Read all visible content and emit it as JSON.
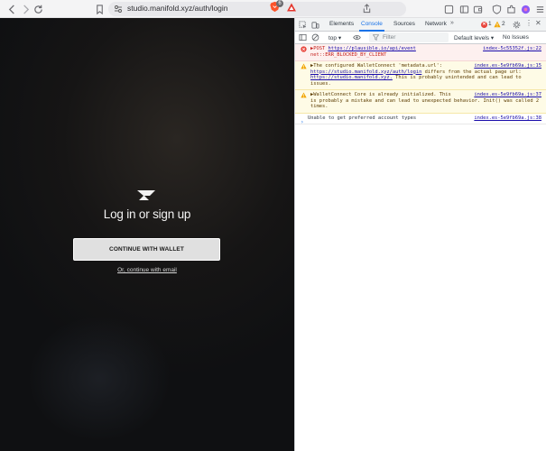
{
  "browser": {
    "url": "studio.manifold.xyz/auth/login",
    "brave_badge_count": "6",
    "tab_count": "6"
  },
  "page": {
    "title": "Log in or sign up",
    "wallet_button": "CONTINUE WITH WALLET",
    "email_link": "Or, continue with email"
  },
  "devtools": {
    "tabs": [
      "Elements",
      "Console",
      "Sources",
      "Network"
    ],
    "active_tab": "Console",
    "more": "»",
    "error_count": "1",
    "warning_count": "2",
    "context": "top",
    "filter_placeholder": "Filter",
    "levels": "Default levels",
    "issues": "No Issues",
    "messages": [
      {
        "type": "error",
        "line1_prefix": "▶POST ",
        "line1_link": "https://plausible.io/api/event",
        "line2": "net::ERR_BLOCKED_BY_CLIENT",
        "source": "index-5c55352f.js:22"
      },
      {
        "type": "warning",
        "line1": "▶The configured WalletConnect 'metadata.url':",
        "link1": "https://studio.manifold.xyz/auth/login",
        "text2": " differs from the actual page url:",
        "link2": "https://studio.manifold.xyz.",
        "text3": " This is probably unintended and can lead to issues.",
        "source": "index.es-5e9fb69a.js:15"
      },
      {
        "type": "warning",
        "line1": "▶WalletConnect Core is already initialized. This",
        "rest": "is probably a mistake and can lead to unexpected behavior. Init() was called 2 times.",
        "source": "index.es-5e9fb69a.js:37"
      },
      {
        "type": "info",
        "line1": "Unable to get preferred account types",
        "source": "index.es-5e9fb69a.js:38"
      }
    ],
    "prompt": "›"
  },
  "colors": {
    "accent": "#1a73e8",
    "error": "#e8453c",
    "warning": "#f2a600"
  }
}
